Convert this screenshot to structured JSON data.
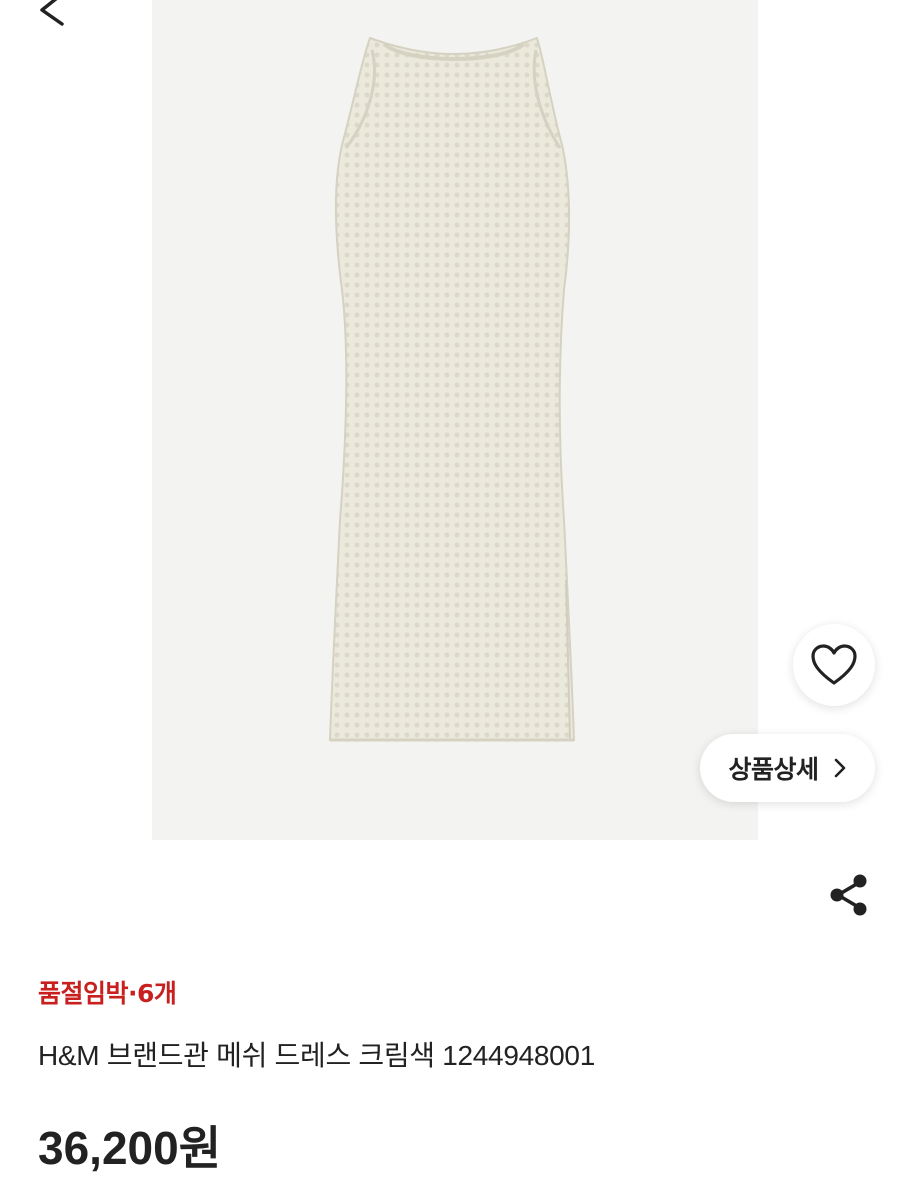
{
  "header": {
    "back_icon": "chevron-left-icon"
  },
  "gallery": {
    "image_subject": "sleeveless cream mesh midi dress",
    "wishlist_icon": "heart-outline-icon",
    "detail_button_label": "상품상세",
    "detail_button_icon": "chevron-right-icon"
  },
  "actions": {
    "share_icon": "share-icon"
  },
  "product": {
    "stock_badge": "품절임박·6개",
    "title": "H&M 브랜드관 메쉬 드레스 크림색 1244948001",
    "price": "36,200원"
  },
  "colors": {
    "accent_red": "#c8201f",
    "text": "#222222",
    "photo_background": "#f3f3f1",
    "dress": "#ebe8dc"
  }
}
